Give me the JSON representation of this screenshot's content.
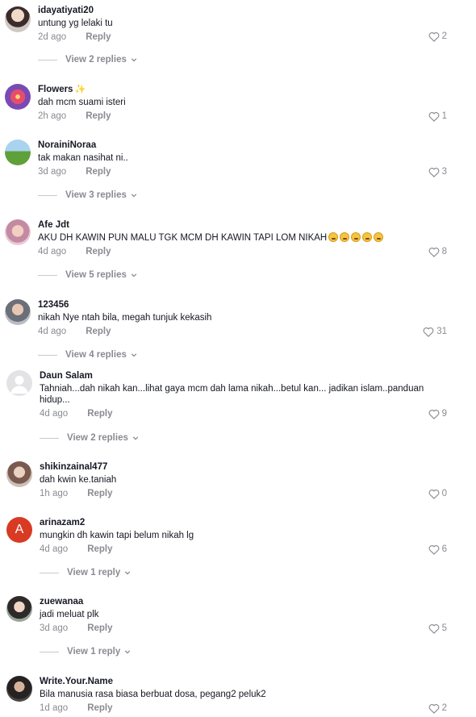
{
  "colors": {
    "muted": "#8a8b91",
    "text": "#161823",
    "avatar_letter_bg": "#d83a24"
  },
  "comments": [
    {
      "user": "idayatiyati20",
      "text": "untung yg lelaki tu",
      "time": "2d ago",
      "reply": "Reply",
      "likes": "2",
      "view_replies": "View 2 replies",
      "avatar": "photo"
    },
    {
      "user": "Flowers",
      "user_suffix": "✨",
      "text": "dah mcm suami isteri",
      "time": "2h ago",
      "reply": "Reply",
      "likes": "1",
      "view_replies": null,
      "avatar": "flower-photo"
    },
    {
      "user": "NorainiNoraa",
      "text": "tak makan nasihat ni..",
      "time": "3d ago",
      "reply": "Reply",
      "likes": "3",
      "view_replies": "View 3 replies",
      "avatar": "photo"
    },
    {
      "user": "Afe Jdt",
      "text": "AKU DH KAWIN PUN MALU TGK MCM DH KAWIN TAPI LOM NIKAH",
      "emoji_count": 5,
      "time": "4d ago",
      "reply": "Reply",
      "likes": "8",
      "view_replies": "View 5 replies",
      "avatar": "photo"
    },
    {
      "user": "123456",
      "text": "nikah Nye ntah bila, megah tunjuk kekasih",
      "time": "4d ago",
      "reply": "Reply",
      "likes": "31",
      "view_replies": "View 4 replies",
      "avatar": "photo"
    },
    {
      "user": "Daun Salam",
      "text": "Tahniah...dah nikah kan...lihat gaya mcm dah lama nikah...betul kan... jadikan islam..panduan hidup...",
      "time": "4d ago",
      "reply": "Reply",
      "likes": "9",
      "view_replies": "View 2 replies",
      "avatar": "default"
    },
    {
      "user": "shikinzainal477",
      "text": "dah kwin ke.taniah",
      "time": "1h ago",
      "reply": "Reply",
      "likes": "0",
      "view_replies": null,
      "avatar": "photo"
    },
    {
      "user": "arinazam2",
      "text": "mungkin dh kawin tapi belum nikah lg",
      "time": "4d ago",
      "reply": "Reply",
      "likes": "6",
      "view_replies": "View 1 reply",
      "avatar": "letter",
      "avatar_letter": "A"
    },
    {
      "user": "zuewanaa",
      "text": "jadi meluat plk",
      "time": "3d ago",
      "reply": "Reply",
      "likes": "5",
      "view_replies": "View 1 reply",
      "avatar": "photo"
    },
    {
      "user": "Write.Your.Name",
      "text": "Bila manusia rasa biasa berbuat dosa, pegang2 peluk2",
      "time": "1d ago",
      "reply": "Reply",
      "likes": "2",
      "view_replies": null,
      "avatar": "photo"
    }
  ]
}
